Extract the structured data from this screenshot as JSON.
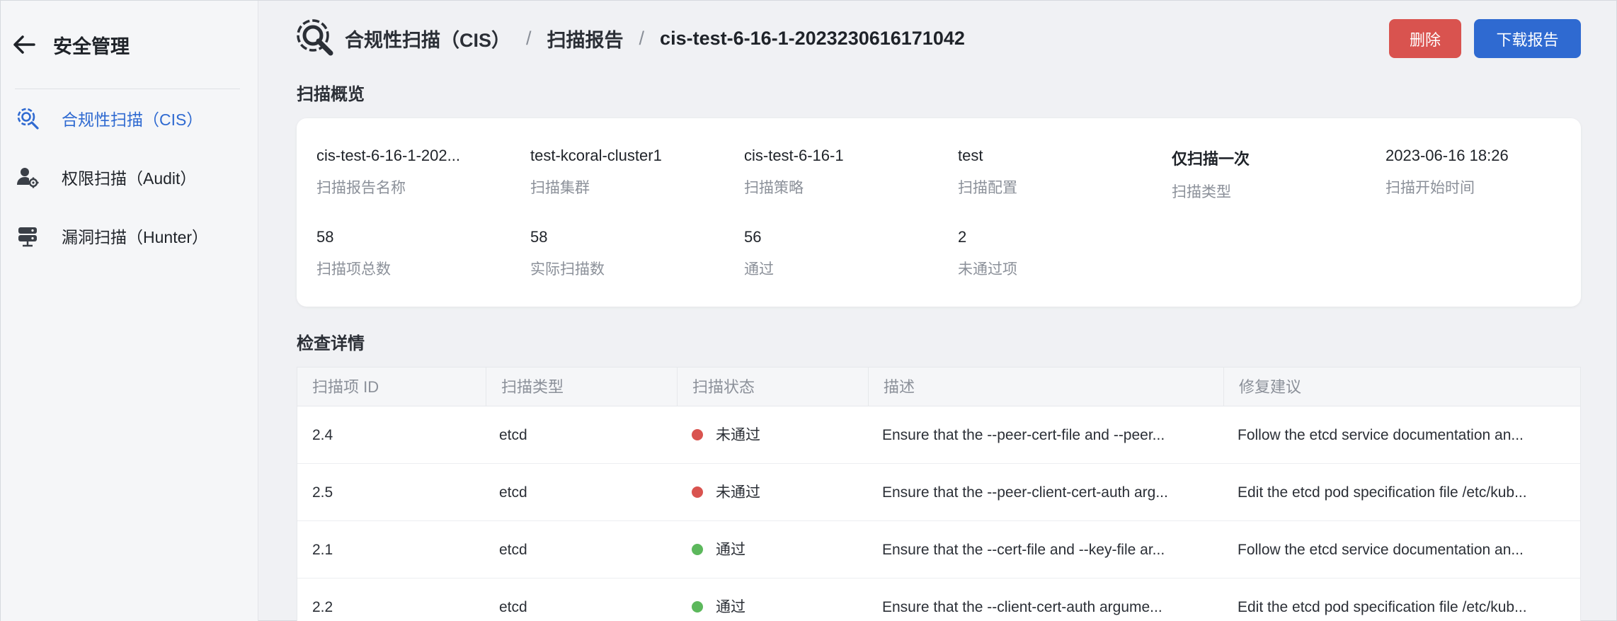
{
  "sidebar": {
    "title": "安全管理",
    "items": [
      {
        "label": "合规性扫描（CIS）",
        "icon": "cis-scan-icon",
        "active": true
      },
      {
        "label": "权限扫描（Audit）",
        "icon": "user-gear-icon",
        "active": false
      },
      {
        "label": "漏洞扫描（Hunter）",
        "icon": "server-stack-icon",
        "active": false
      }
    ]
  },
  "breadcrumb": {
    "root": "合规性扫描（CIS）",
    "sep": "/",
    "middle": "扫描报告",
    "current": "cis-test-6-16-1-2023230616171042"
  },
  "buttons": {
    "delete": "删除",
    "download": "下载报告"
  },
  "overview": {
    "title": "扫描概览",
    "fields": [
      {
        "value": "cis-test-6-16-1-202...",
        "label": "扫描报告名称"
      },
      {
        "value": "test-kcoral-cluster1",
        "label": "扫描集群"
      },
      {
        "value": "cis-test-6-16-1",
        "label": "扫描策略"
      },
      {
        "value": "test",
        "label": "扫描配置"
      },
      {
        "value": "仅扫描一次",
        "label": "扫描类型"
      },
      {
        "value": "2023-06-16 18:26",
        "label": "扫描开始时间"
      },
      {
        "value": "58",
        "label": "扫描项总数"
      },
      {
        "value": "58",
        "label": "实际扫描数"
      },
      {
        "value": "56",
        "label": "通过"
      },
      {
        "value": "2",
        "label": "未通过项"
      }
    ]
  },
  "details": {
    "title": "检查详情",
    "columns": [
      "扫描项 ID",
      "扫描类型",
      "扫描状态",
      "描述",
      "修复建议"
    ],
    "rows": [
      {
        "id": "2.4",
        "type": "etcd",
        "status": "未通过",
        "desc": "Ensure that the --peer-cert-file and --peer...",
        "fix": "Follow the etcd service documentation an..."
      },
      {
        "id": "2.5",
        "type": "etcd",
        "status": "未通过",
        "desc": "Ensure that the --peer-client-cert-auth arg...",
        "fix": "Edit the etcd pod specification file /etc/kub..."
      },
      {
        "id": "2.1",
        "type": "etcd",
        "status": "通过",
        "desc": "Ensure that the --cert-file and --key-file ar...",
        "fix": "Follow the etcd service documentation an..."
      },
      {
        "id": "2.2",
        "type": "etcd",
        "status": "通过",
        "desc": "Ensure that the --client-cert-auth argume...",
        "fix": "Edit the etcd pod specification file /etc/kub..."
      }
    ]
  },
  "colors": {
    "accent": "#2f6ad1",
    "danger": "#d9534f",
    "fail": "#d9534f",
    "pass": "#5cb85c"
  }
}
